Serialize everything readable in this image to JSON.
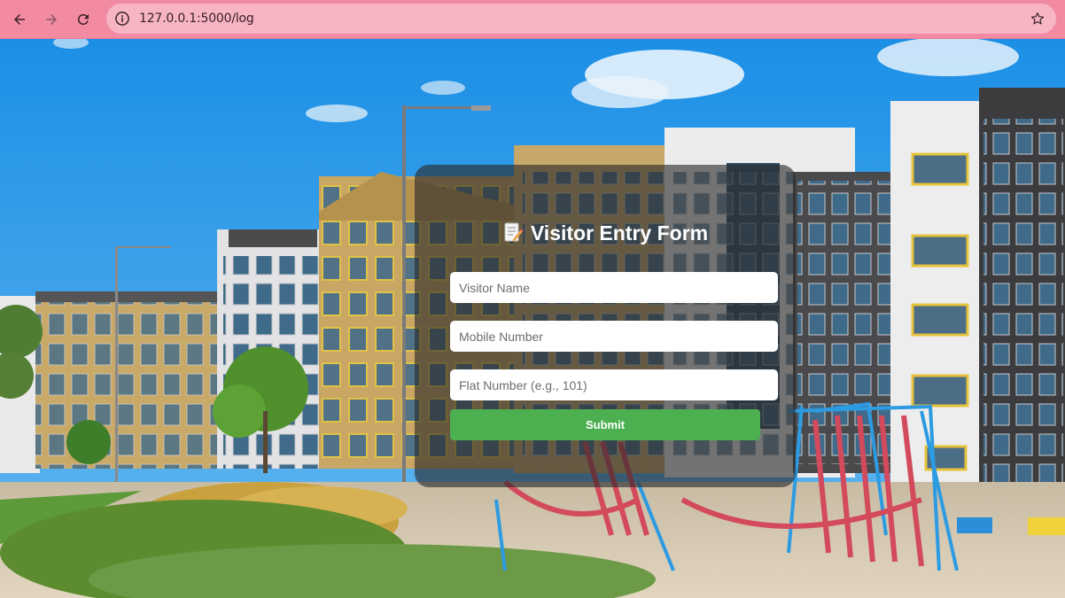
{
  "browser": {
    "url": "127.0.0.1:5000/log",
    "icons": [
      "back-arrow-icon",
      "forward-arrow-icon",
      "reload-icon",
      "site-info-icon",
      "bookmark-star-icon"
    ]
  },
  "form": {
    "title": "Visitor Entry Form",
    "title_icon": "memo-icon",
    "fields": [
      {
        "placeholder": "Visitor Name",
        "value": ""
      },
      {
        "placeholder": "Mobile Number",
        "value": ""
      },
      {
        "placeholder": "Flat Number (e.g., 101)",
        "value": ""
      }
    ],
    "submit_label": "Submit"
  },
  "colors": {
    "chrome": "#f28ba2",
    "address_bar": "#f7b5c4",
    "submit": "#4caf50",
    "card": "rgba(40,40,40,0.62)"
  }
}
